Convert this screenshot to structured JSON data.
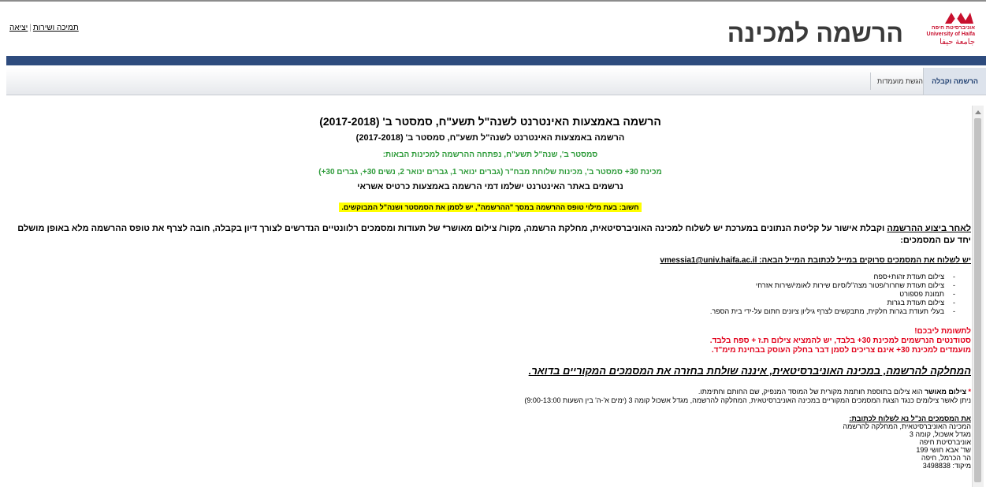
{
  "window": {
    "title": "הרשמה למכינה",
    "links": {
      "support": "תמיכה ושירות",
      "exit": "יציאה"
    },
    "logo": {
      "hebrew": "אוניברסיטת חיפה",
      "english": "University of Haifa",
      "arabic": "جامعة حيفا"
    }
  },
  "tabs": [
    {
      "label": "הרשמה וקבלה",
      "active": true
    },
    {
      "label": "הגשת מועמדות",
      "active": false
    }
  ],
  "main": {
    "heading1": "הרשמה באמצעות האינטרנט לשנה\"ל תשע\"ח, סמסטר ב' (2017-2018)",
    "heading2": "הרשמה באמצעות האינטרנט לשנה\"ל תשע\"ח, סמסטר ב' (2017-2018)",
    "green1": "סמסטר ב', שנה\"ל תשע\"ח, נפתחה ההרשמה למכינות הבאות:",
    "green2": "מכינת 30+ סמסטר ב', מכינות שלוחת מבח\"ר (גברים ינואר 1, גברים ינואר 2, נשים 30+, גברים 30+)",
    "payment": "נרשמים באתר האינטרנט ישלמו דמי הרשמה באמצעות כרטיס אשראי",
    "warning": "חשוב: בעת מילוי טופס ההרשמה במסך \"ההרשמה\", יש לסמן את הסמסטר ושנה\"ל המבוקשים.",
    "para_underlined": "לאחר ביצוע ההרשמה",
    "para_rest": " וקבלת אישור על קליטת הנתונים במערכת יש לשלוח למכינה האוניברסיטאית, מחלקת הרשמה, מקור/ צילום מאושר* של תעודות ומסמכים רלוונטיים הנדרשים לצורך דיון בקבלה, חובה לצרף את טופס ההרשמה מלא באופן מושלם יחד עם המסמכים:",
    "email_line": "יש לשלוח את המסמכים סרוקים במייל לכתובת המייל הבאה: vmessia1@univ.haifa.ac.il",
    "documents": [
      "צילום תעודת זהות+ספח",
      "צילום תעודת שחרור/פטור מצה\"ל/סיום שירות לאומי/שירות אזרחי",
      "תמונת פספורט",
      "צילום תעודת בגרות",
      "בעלי תעודת בגרות חלקית, מתבקשים לצרף גיליון ציונים חתום על-ידי בית הספר."
    ],
    "attention": [
      "לתשומת ליבכם!",
      "סטודנטים הנרשמים למכינת 30+ בלבד, יש להמציא צילום ת.ז + ספח בלבד.",
      "מועמדים למכינת 30+ אינם צריכים לסמן דבר בחלק העוסק בבחינת מימ\"ד."
    ],
    "notice": "המחלקה להרשמה, במכינה האוניברסיטאית, איננה שולחת בחזרה את המסמכים המקוריים בדואר.",
    "footnote_star": "*",
    "footnote_bold": "צילום מאושר",
    "footnote_rest": " הוא צילום בתוספת חותמת מקורית של המוסד המנפיק, שם החותם וחתימתו.",
    "footnote_line2": "ניתן לאשר צילומים כנגד הצגת המסמכים המקוריים במכינה האוניברסיטאית, המחלקה להרשמה, מגדל  אשכול קומה 3 (ימים א'-ה' בין השעות 9:00-13:00)",
    "address_title": "את המסמכים הנ\"ל נא לשלוח לכתובת:",
    "address_lines": [
      "המכינה האוניברסיטאית, המחלקה להרשמה",
      "מגדל אשכול, קומה 3",
      "אוניברסיטת חיפה",
      "שד' אבא חושי 199",
      "הר הכרמל, חיפה",
      "מיקוד: 3498838"
    ]
  },
  "colors": {
    "brand_blue": "#2e4c7e",
    "green_text": "#2e9b3a",
    "red_text": "#e2001a",
    "highlight": "#ffff00"
  }
}
